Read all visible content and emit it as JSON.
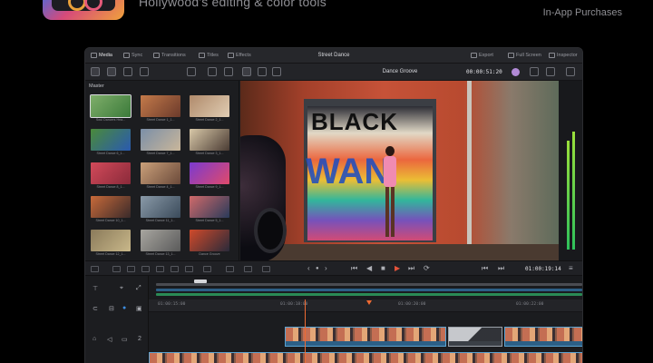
{
  "store": {
    "tagline": "Hollywood's editing & color tools",
    "in_app": "In-App Purchases"
  },
  "window": {
    "top_tabs": [
      {
        "label": "Media",
        "icon": "media-icon"
      },
      {
        "label": "Sync",
        "icon": "sync-icon"
      },
      {
        "label": "Transitions",
        "icon": "transitions-icon"
      },
      {
        "label": "Titles",
        "icon": "titles-icon"
      },
      {
        "label": "Effects",
        "icon": "effects-icon"
      }
    ],
    "project_title": "Street Dance",
    "right_tabs": [
      {
        "label": "Export",
        "icon": "export-icon"
      },
      {
        "label": "Full Screen",
        "icon": "fullscreen-icon"
      },
      {
        "label": "Inspector",
        "icon": "inspector-icon"
      }
    ],
    "timeline_name": "Dance Groove",
    "viewer_timecode": "00:00:51:20",
    "transport_timecode": "01:00:19:14"
  },
  "media_pool": {
    "header": "Master",
    "clips": [
      {
        "caption": "Soul Dancers Hea...",
        "c1": "#7fae6a",
        "c2": "#3b7a3a"
      },
      {
        "caption": "Street Dance 1_1...",
        "c1": "#c47a4a",
        "c2": "#6b3a2b"
      },
      {
        "caption": "Street Dance 2_1...",
        "c1": "#b08a6b",
        "c2": "#e0cdb3"
      },
      {
        "caption": "Street Dance 6_1...",
        "c1": "#4a8a3a",
        "c2": "#2a5ab0"
      },
      {
        "caption": "Street Dance 7_1...",
        "c1": "#7b8fa8",
        "c2": "#c9b69a"
      },
      {
        "caption": "Street Dance 3_1...",
        "c1": "#d8c8a8",
        "c2": "#4a3b33"
      },
      {
        "caption": "Street Dance 8_1...",
        "c1": "#d24a5a",
        "c2": "#8a2a3a"
      },
      {
        "caption": "Street Dance 4_1...",
        "c1": "#caa07a",
        "c2": "#6b4a3a"
      },
      {
        "caption": "Street Dance 9_1...",
        "c1": "#7a3ad0",
        "c2": "#e04a6a"
      },
      {
        "caption": "Street Dance 10_1...",
        "c1": "#c86a3a",
        "c2": "#3a2a2a"
      },
      {
        "caption": "Street Dance 11_1...",
        "c1": "#8a9aa8",
        "c2": "#3a4a5a"
      },
      {
        "caption": "Street Dance 5_1...",
        "c1": "#d06a6a",
        "c2": "#2a3a5a"
      },
      {
        "caption": "Street Dance 12_1...",
        "c1": "#8a7a5a",
        "c2": "#c9b88a"
      },
      {
        "caption": "Street Dance 13_1...",
        "c1": "#a8a6a0",
        "c2": "#5a5a5a"
      },
      {
        "caption": "Dance Groove",
        "c1": "#d04a2a",
        "c2": "#2a2a3a"
      }
    ]
  },
  "ruler": {
    "labels": [
      "01:00:15:00",
      "01:00:18:00",
      "01:00:20:00",
      "01:00:22:00"
    ]
  },
  "colors": {
    "accent_orange": "#ef6a32",
    "clip_blue": "#2c5f86",
    "meter_green": "#2ec15b"
  }
}
